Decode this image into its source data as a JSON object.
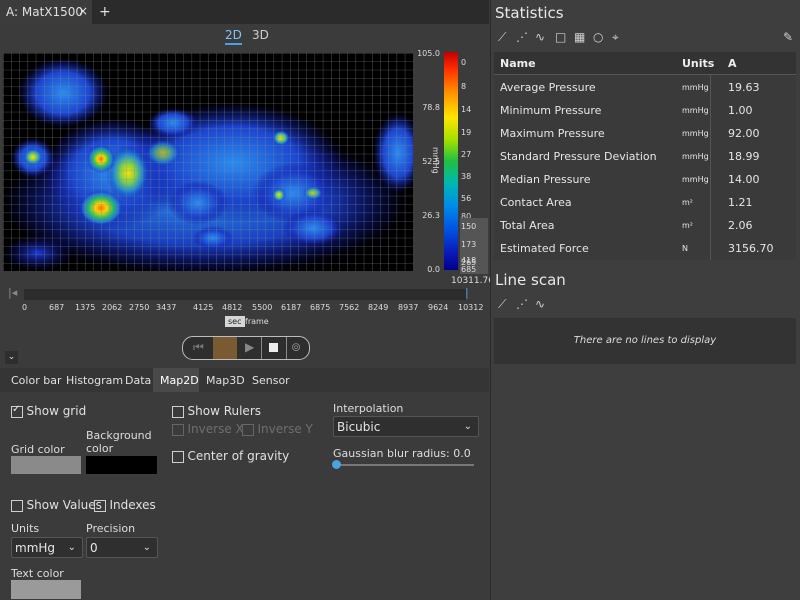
{
  "tabs": {
    "active_label": "A: MatX1500",
    "close": "×",
    "add": "+"
  },
  "view_toggle": {
    "option_2d": "2D",
    "option_3d": "3D",
    "selected": "2D"
  },
  "colorbar": {
    "axis_ticks": [
      "105.0",
      "78.8",
      "52.5",
      "26.3",
      "0.0"
    ],
    "unit": "mmHg",
    "count_ticks": [
      "0",
      "8",
      "14",
      "19",
      "27",
      "38",
      "56",
      "80",
      "109",
      "150",
      "173",
      "265",
      "418",
      "685"
    ],
    "total": "10311.76"
  },
  "heatmap": {
    "grid_lines": true
  },
  "timeline": {
    "ticks": [
      "0",
      "687",
      "1375",
      "2062",
      "2750",
      "3437",
      "4125",
      "4812",
      "5500",
      "6187",
      "6875",
      "7562",
      "8249",
      "8937",
      "9624",
      "10312"
    ],
    "unit": "sec",
    "unit_alt": "frame"
  },
  "playback": {
    "icons": [
      "skip-back-icon",
      "record-icon",
      "play-icon",
      "stop-icon",
      "loop-icon"
    ]
  },
  "settings_tabs": [
    "Color bar",
    "Histogram",
    "Data",
    "Map2D",
    "Map3D",
    "Sensor"
  ],
  "settings_active_tab": "Map2D",
  "map2d": {
    "show_grid": "Show grid",
    "show_grid_checked": true,
    "grid_color_label": "Grid color",
    "grid_color": "#8a8a8a",
    "background_label": "Background color",
    "background_color": "#000000",
    "show_rulers": "Show Rulers",
    "inverse_x": "Inverse X",
    "inverse_y": "Inverse Y",
    "center_gravity": "Center of gravity",
    "interpolation_label": "Interpolation",
    "interpolation_value": "Bicubic",
    "blur_label": "Gaussian blur radius: 0.0",
    "blur_value": 0.0,
    "show_values": "Show Values",
    "indexes": "Indexes",
    "units_label": "Units",
    "units_value": "mmHg",
    "precision_label": "Precision",
    "precision_value": "0",
    "text_color_label": "Text color",
    "text_color": "#9a9a9a"
  },
  "statistics": {
    "title": "Statistics",
    "headers": [
      "Name",
      "Units",
      "A"
    ],
    "rows": [
      [
        "Average Pressure",
        "mmHg",
        "19.63"
      ],
      [
        "Minimum Pressure",
        "mmHg",
        "1.00"
      ],
      [
        "Maximum Pressure",
        "mmHg",
        "92.00"
      ],
      [
        "Standard Pressure Deviation",
        "mmHg",
        "18.99"
      ],
      [
        "Median Pressure",
        "mmHg",
        "14.00"
      ],
      [
        "Contact Area",
        "m²",
        "1.21"
      ],
      [
        "Total Area",
        "m²",
        "2.06"
      ],
      [
        "Estimated Force",
        "N",
        "3156.70"
      ]
    ],
    "toolbar_icons": [
      "line-chart-icon",
      "scatter-icon",
      "curve-icon",
      "square-icon",
      "grid-square-icon",
      "circle-icon",
      "crosshair-icon",
      "eraser-icon"
    ]
  },
  "line_scan": {
    "title": "Line scan",
    "empty_text": "There are no lines to display",
    "toolbar_icons": [
      "line-chart-icon",
      "scatter-icon",
      "curve-icon"
    ]
  },
  "colors": {
    "accent": "#4aa3df",
    "panel": "#3c3c3c",
    "dark": "#2b2b2b"
  }
}
